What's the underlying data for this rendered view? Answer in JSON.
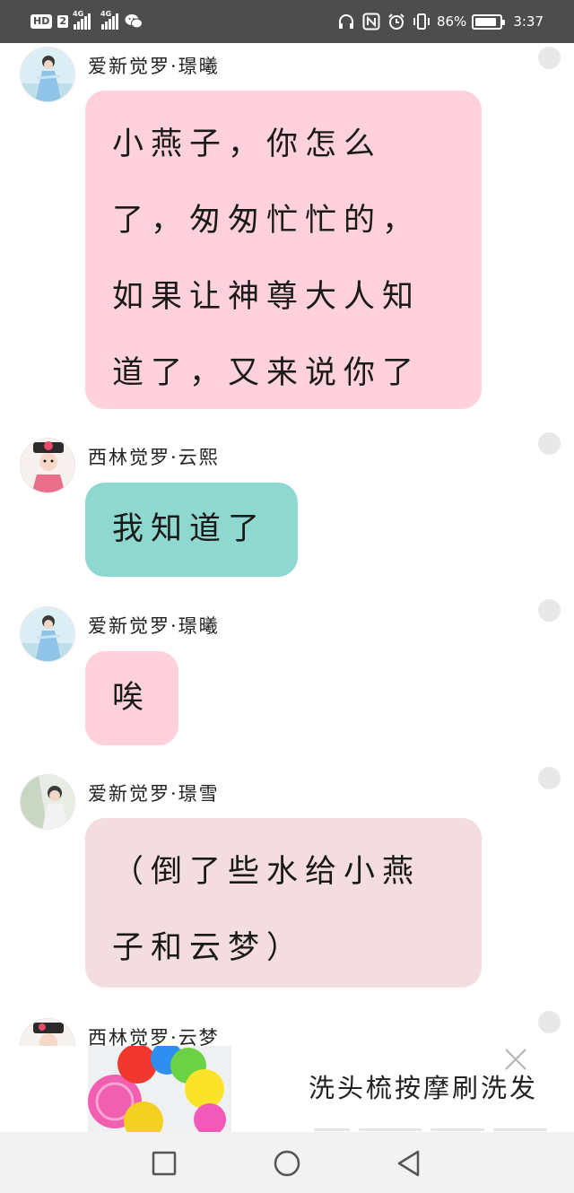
{
  "status_bar": {
    "hd_label": "HD",
    "hd_sim": "2",
    "network1": "4G",
    "network2": "4G",
    "battery_percent_text": "86%",
    "battery_level": 0.86,
    "time": "3:37",
    "icons": [
      "headphones-icon",
      "nfc-icon",
      "alarm-icon",
      "vibrate-icon",
      "wechat-icon"
    ]
  },
  "messages": [
    {
      "sender": "爱新觉罗·璟曦",
      "lines": [
        "小燕子，你怎么",
        "了，匆匆忙忙的，",
        "如果让神尊大人知",
        "道了，又来说你了"
      ],
      "bubble_color": "#fed1dc"
    },
    {
      "sender": "西林觉罗·云熙",
      "lines": [
        "我知道了"
      ],
      "bubble_color": "#8ed8cf"
    },
    {
      "sender": "爱新觉罗·璟曦",
      "lines": [
        "唉"
      ],
      "bubble_color": "#fed1dc"
    },
    {
      "sender": "爱新觉罗·璟雪",
      "lines": [
        "（倒了些水给小燕",
        "子和云梦）"
      ],
      "bubble_color": "#f4dde0"
    },
    {
      "sender": "西林觉罗·云梦",
      "lines": [],
      "bubble_color": ""
    }
  ],
  "ad": {
    "title": "洗头梳按摩刷洗发",
    "close_icon": "close-icon"
  },
  "nav": {
    "icons": [
      "recent-apps-icon",
      "home-icon",
      "back-icon"
    ]
  }
}
